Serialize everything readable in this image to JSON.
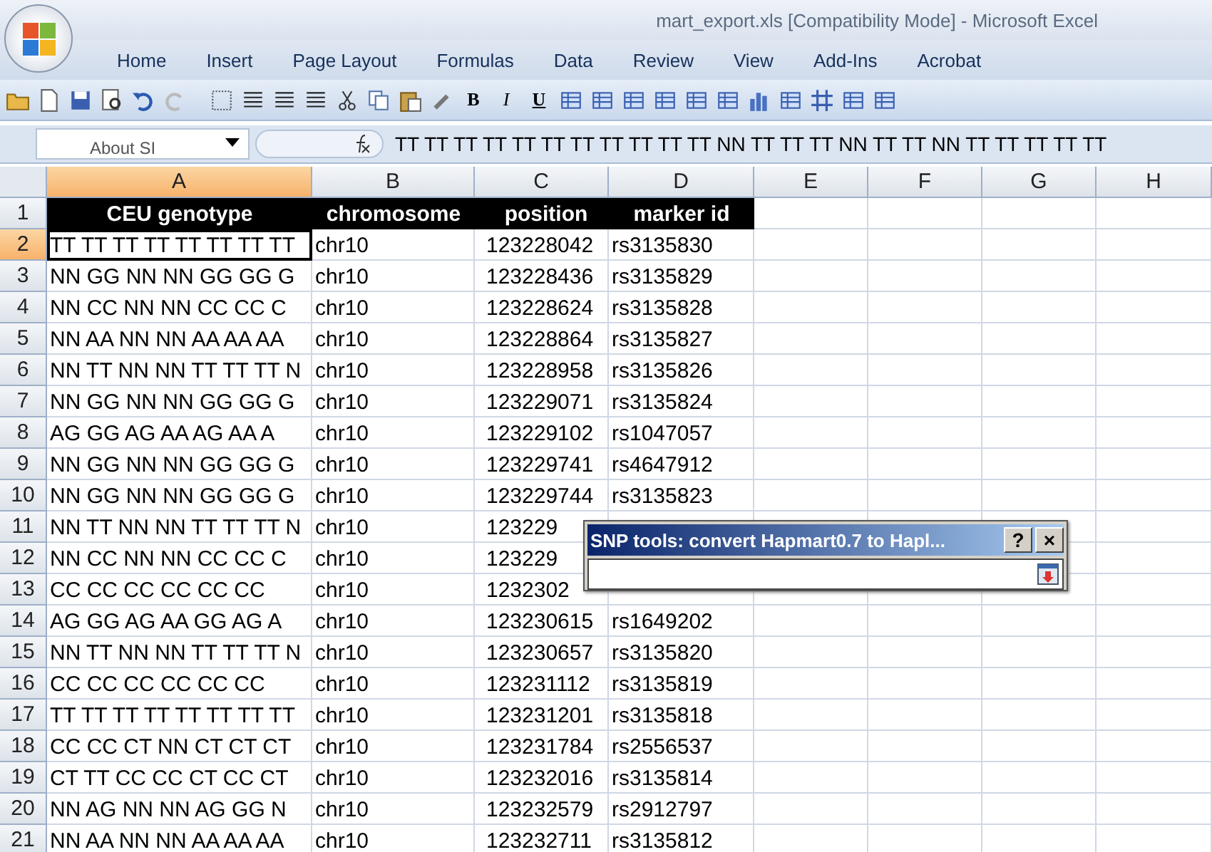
{
  "window": {
    "title": "mart_export.xls  [Compatibility Mode]  -  Microsoft Excel"
  },
  "ribbon_tabs": [
    "Home",
    "Insert",
    "Page Layout",
    "Formulas",
    "Data",
    "Review",
    "View",
    "Add-Ins",
    "Acrobat"
  ],
  "format_buttons": [
    {
      "label": "B",
      "kind": "bold"
    },
    {
      "label": "I",
      "kind": "italic"
    },
    {
      "label": "U",
      "kind": "underline"
    }
  ],
  "name_box": "About SI",
  "formula": "TT TT TT TT TT TT TT TT TT TT TT NN TT TT TT NN TT TT NN TT TT TT TT TT",
  "columns": [
    {
      "label": "A",
      "selected": true
    },
    {
      "label": "B",
      "selected": false
    },
    {
      "label": "C",
      "selected": false
    },
    {
      "label": "D",
      "selected": false
    },
    {
      "label": "E",
      "selected": false
    },
    {
      "label": "F",
      "selected": false
    },
    {
      "label": "G",
      "selected": false
    },
    {
      "label": "H",
      "selected": false
    }
  ],
  "rows": [
    {
      "number": "1",
      "kind": "header",
      "selected": false,
      "cells": [
        "CEU genotype",
        "chromosome",
        "position",
        "marker id"
      ]
    },
    {
      "number": "2",
      "kind": "data",
      "selected": true,
      "cells": [
        "TT TT TT TT TT TT TT TT",
        "chr10",
        "123228042",
        "rs3135830"
      ]
    },
    {
      "number": "3",
      "kind": "data",
      "selected": false,
      "cells": [
        "NN GG NN NN GG GG G",
        "chr10",
        "123228436",
        "rs3135829"
      ]
    },
    {
      "number": "4",
      "kind": "data",
      "selected": false,
      "cells": [
        "NN CC NN NN CC CC C",
        "chr10",
        "123228624",
        "rs3135828"
      ]
    },
    {
      "number": "5",
      "kind": "data",
      "selected": false,
      "cells": [
        "NN AA NN NN AA AA AA",
        "chr10",
        "123228864",
        "rs3135827"
      ]
    },
    {
      "number": "6",
      "kind": "data",
      "selected": false,
      "cells": [
        "NN TT NN NN TT TT TT N",
        "chr10",
        "123228958",
        "rs3135826"
      ]
    },
    {
      "number": "7",
      "kind": "data",
      "selected": false,
      "cells": [
        "NN GG NN NN GG GG G",
        "chr10",
        "123229071",
        "rs3135824"
      ]
    },
    {
      "number": "8",
      "kind": "data",
      "selected": false,
      "cells": [
        "AG GG AG AA AG AA A",
        "chr10",
        "123229102",
        "rs1047057"
      ]
    },
    {
      "number": "9",
      "kind": "data",
      "selected": false,
      "cells": [
        "NN GG NN NN GG GG G",
        "chr10",
        "123229741",
        "rs4647912"
      ]
    },
    {
      "number": "10",
      "kind": "data",
      "selected": false,
      "cells": [
        "NN GG NN NN GG GG G",
        "chr10",
        "123229744",
        "rs3135823"
      ]
    },
    {
      "number": "11",
      "kind": "data",
      "selected": false,
      "cells": [
        "NN TT NN NN TT TT TT N",
        "chr10",
        "123229"
      ]
    },
    {
      "number": "12",
      "kind": "data",
      "selected": false,
      "cells": [
        "NN CC NN NN CC CC C",
        "chr10",
        "123229"
      ]
    },
    {
      "number": "13",
      "kind": "data",
      "selected": false,
      "cells": [
        "CC CC CC CC CC CC",
        "chr10",
        "1232302"
      ]
    },
    {
      "number": "14",
      "kind": "data",
      "selected": false,
      "cells": [
        "AG GG AG AA GG AG A",
        "chr10",
        "123230615",
        "rs1649202"
      ]
    },
    {
      "number": "15",
      "kind": "data",
      "selected": false,
      "cells": [
        "NN TT NN NN TT TT TT N",
        "chr10",
        "123230657",
        "rs3135820"
      ]
    },
    {
      "number": "16",
      "kind": "data",
      "selected": false,
      "cells": [
        "CC CC CC CC CC CC",
        "chr10",
        "123231112",
        "rs3135819"
      ]
    },
    {
      "number": "17",
      "kind": "data",
      "selected": false,
      "cells": [
        "TT TT TT TT TT TT TT TT",
        "chr10",
        "123231201",
        "rs3135818"
      ]
    },
    {
      "number": "18",
      "kind": "data",
      "selected": false,
      "cells": [
        "CC CC CT NN CT CT CT",
        "chr10",
        "123231784",
        "rs2556537"
      ]
    },
    {
      "number": "19",
      "kind": "data",
      "selected": false,
      "cells": [
        "CT TT CC CC CT CC CT",
        "chr10",
        "123232016",
        "rs3135814"
      ]
    },
    {
      "number": "20",
      "kind": "data",
      "selected": false,
      "cells": [
        "NN AG NN NN AG GG N",
        "chr10",
        "123232579",
        "rs2912797"
      ]
    },
    {
      "number": "21",
      "kind": "data",
      "selected": false,
      "cells": [
        "NN AA NN NN AA AA AA",
        "chr10",
        "123232711",
        "rs3135812"
      ]
    }
  ],
  "dialog": {
    "title": "SNP tools: convert Hapmart0.7 to Hapl...",
    "help": "?",
    "close": "×"
  }
}
